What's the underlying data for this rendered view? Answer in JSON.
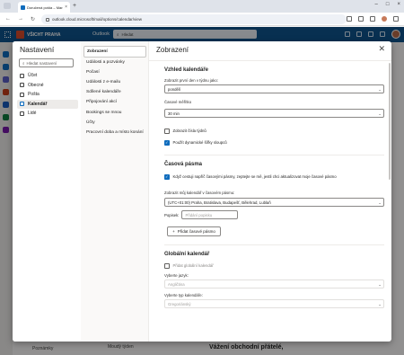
{
  "browser": {
    "tab_title": "Doručená pošta – Marek Anton",
    "url": "outlook.cloud.microsoft/mail/options/calendar/view"
  },
  "outlook": {
    "brand": "VŠICHT PRAHA",
    "app_name": "Outlook",
    "search_placeholder": "Hledat"
  },
  "background": {
    "footer_left": "Poznámky",
    "footer_mid": "Moudý týden",
    "greeting": "Vážení obchodní přátelé,"
  },
  "settings": {
    "title": "Nastavení",
    "search_placeholder": "Hledat nastavení",
    "categories": [
      {
        "label": "Účet",
        "icon": "person-icon"
      },
      {
        "label": "Obecné",
        "icon": "gear-icon"
      },
      {
        "label": "Pošta",
        "icon": "mail-icon"
      },
      {
        "label": "Kalendář",
        "icon": "calendar-icon",
        "selected": true
      },
      {
        "label": "Lidé",
        "icon": "people-icon"
      }
    ],
    "subcategories": [
      {
        "label": "Zobrazení",
        "selected": true
      },
      {
        "label": "Události a pozvánky"
      },
      {
        "label": "Počasí"
      },
      {
        "label": "Události z e-mailu"
      },
      {
        "label": "Sdílené kalendáře"
      },
      {
        "label": "Připojování akcí"
      },
      {
        "label": "Bookings se mnou"
      },
      {
        "label": "Účty"
      },
      {
        "label": "Pracovní doba a místo konání"
      }
    ]
  },
  "content": {
    "title": "Zobrazení",
    "calendar_view": {
      "heading": "Vzhled kalendáře",
      "first_day_label": "Zobrazit první den v týdnu jako:",
      "first_day_value": "pondělí",
      "scale_label": "Časové měřítko",
      "scale_value": "30 min",
      "week_numbers_label": "Zobrazit čísla týdnů",
      "week_numbers_checked": false,
      "dynamic_columns_label": "Použít dynamické šířky sloupců",
      "dynamic_columns_checked": true
    },
    "time_zones": {
      "heading": "Časová pásma",
      "travel_label": "Když cestuji napříč časovými pásmy, zeptejte se mě, jestli chci aktualizovat moje časové pásmo",
      "travel_checked": true,
      "show_in_label": "Zobrazit můj kalendář v časovém pásmu:",
      "zone_value": "(UTC+01:00) Praha, Bratislava, Budapešť, Bělehrad, Lublaň",
      "caption_label": "Popisek:",
      "caption_placeholder": "Přidání popisku",
      "add_zone_label": "Přidat časové pásmo"
    },
    "global_calendar": {
      "heading": "Globální kalendář",
      "show_label": "Přidat globální kalendář",
      "show_checked": false,
      "language_label": "Vyberte jazyk:",
      "language_value": "Angličtina",
      "type_label": "Vyberte typ kalendáře:",
      "type_value": "Gregoriánský"
    }
  },
  "colors": {
    "accent": "#0f6cbd",
    "header": "#0f548c"
  }
}
